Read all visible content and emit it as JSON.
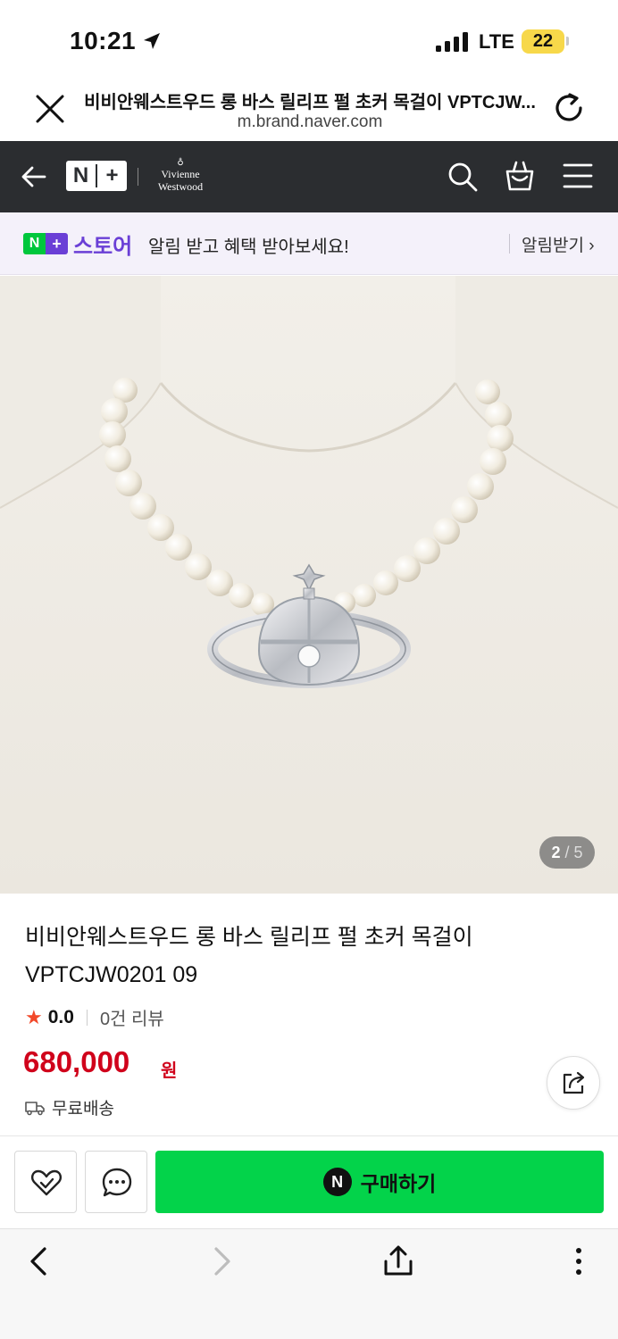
{
  "status_bar": {
    "time": "10:21",
    "network": "LTE",
    "battery": "22"
  },
  "browser": {
    "page_title": "비비안웨스트우드 롱 바스 릴리프 펄 초커 목걸이 VPTCJW...",
    "domain": "m.brand.naver.com"
  },
  "site_nav": {
    "logo_text": "N+",
    "brand_line1": "Vivienne",
    "brand_line2": "Westwood"
  },
  "banner": {
    "badge_n": "N",
    "badge_plus": "+",
    "store_label": "스토어",
    "message": "알림 받고 혜택 받아보세요!",
    "action_label": "알림받기 ›"
  },
  "gallery": {
    "current": "2",
    "total": "5"
  },
  "product": {
    "name_line1": "비비안웨스트우드 롱 바스 릴리프 펄 초커 목걸이",
    "name_line2": "VPTCJW0201 09",
    "rating": "0.0",
    "review_count": "0건 리뷰",
    "price": "680,000",
    "currency": "원",
    "shipping": "무료배송"
  },
  "actions": {
    "buy_icon": "N",
    "buy_label": "구매하기"
  },
  "colors": {
    "nav_bg": "#2b2d30",
    "naver_green": "#03d34a",
    "price_red": "#d0021b",
    "plus_purple": "#6a3fd6"
  }
}
